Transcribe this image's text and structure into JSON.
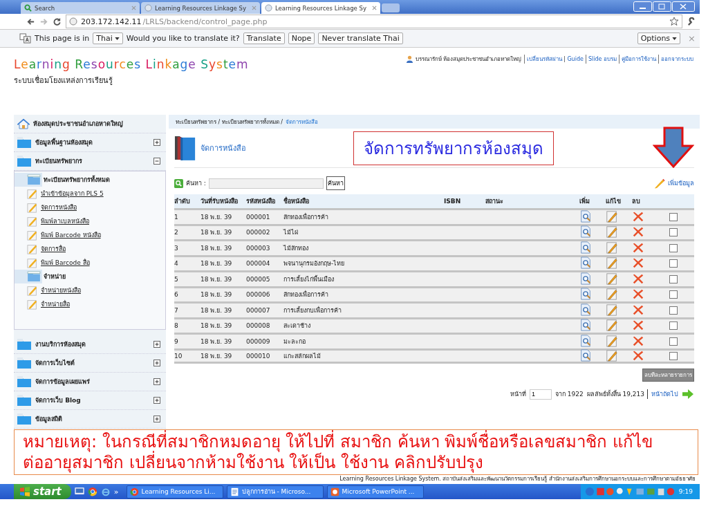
{
  "browser": {
    "tabs": [
      {
        "label": "Search",
        "kind": "search",
        "selected": false
      },
      {
        "label": "Learning Resources Linkage Sy",
        "kind": "page",
        "selected": false
      },
      {
        "label": "Learning Resources Linkage Sy",
        "kind": "page",
        "selected": true
      }
    ],
    "url_host": "203.172.142.11",
    "url_path": "/LRLS/backend/control_page.php",
    "translate_bar": {
      "prefix": "This page is in",
      "language": "Thai",
      "question": "Would you like to translate it?",
      "buttons": [
        "Translate",
        "Nope",
        "Never translate Thai"
      ],
      "options": "Options",
      "close": "×"
    }
  },
  "header": {
    "logo": "Learning Resources Linkage System",
    "subtitle": "ระบบเชื่อมโยงแหล่งการเรียนรู้",
    "user": "บรรณารักษ์ ห้องสมุดประชาชนอำเภอหาดใหญ่",
    "links": [
      "เปลี่ยนรหัสผ่าน",
      "Guide",
      "Slide อบรม",
      "คู่มือการใช้งาน",
      "ออกจากระบบ"
    ]
  },
  "sidebar": {
    "header": "ห้องสมุดประชาชนอำเภอหาดใหญ่",
    "groups": [
      {
        "label": "ข้อมูลพื้นฐานห้องสมุด",
        "expanded": false
      },
      {
        "label": "ทะเบียนทรัพยากร",
        "expanded": true,
        "children": [
          {
            "label": "ทะเบียนทรัพยากรทั้งหมด",
            "kind": "folder"
          },
          {
            "label": "นำเข้าข้อมูลจาก PLS 5",
            "kind": "link"
          },
          {
            "label": "จัดการหนังสือ",
            "kind": "link"
          },
          {
            "label": "พิมพ์ลาเบลหนังสือ",
            "kind": "link"
          },
          {
            "label": "พิมพ์ Barcode หนังสือ",
            "kind": "link"
          },
          {
            "label": "จัดการสื่อ",
            "kind": "link"
          },
          {
            "label": "พิมพ์ Barcode สื่อ",
            "kind": "link"
          },
          {
            "label": "จำหน่าย",
            "kind": "folder"
          },
          {
            "label": "จำหน่ายหนังสือ",
            "kind": "link"
          },
          {
            "label": "จำหน่ายสื่อ",
            "kind": "link"
          }
        ]
      },
      {
        "label": "งานบริการห้องสมุด",
        "expanded": false
      },
      {
        "label": "จัดการเว็บไซต์",
        "expanded": false
      },
      {
        "label": "จัดการข้อมูลเผยแพร่",
        "expanded": false
      },
      {
        "label": "จัดการเว็บ Blog",
        "expanded": false
      },
      {
        "label": "ข้อมูลสถิติ",
        "expanded": false
      }
    ]
  },
  "content": {
    "breadcrumb": {
      "path": "ทะเบียนทรัพยากร / ทะเบียนทรัพยากรทั้งหมด /",
      "current": "จัดการหนังสือ"
    },
    "title": "จัดการหนังสือ",
    "callout": "จัดการทรัพยากรห้องสมุด",
    "add_link": "เพิ่มข้อมูล",
    "search": {
      "label": "ค้นหา :",
      "button": "ค้นหา"
    },
    "table": {
      "columns": [
        "ลำดับ",
        "วันที่รับหนังสือ",
        "รหัสหนังสือ",
        "ชื่อหนังสือ",
        "ISBN",
        "สถานะ",
        "เพิ่ม",
        "แก้ไข",
        "ลบ"
      ],
      "rows": [
        {
          "no": "1",
          "date": "18 พ.ย. 39",
          "code": "000001",
          "name": "สักทองเพื่อการค้า",
          "checked": false
        },
        {
          "no": "2",
          "date": "18 พ.ย. 39",
          "code": "000002",
          "name": "ไม้ไผ่",
          "checked": false
        },
        {
          "no": "3",
          "date": "18 พ.ย. 39",
          "code": "000003",
          "name": "ไม้สักทอง",
          "checked": false
        },
        {
          "no": "4",
          "date": "18 พ.ย. 39",
          "code": "000004",
          "name": "พจนานุกรมอังกฤษ-ไทย",
          "checked": false
        },
        {
          "no": "5",
          "date": "18 พ.ย. 39",
          "code": "000005",
          "name": "การเลี้ยงไก่พื้นเมือง",
          "checked": false
        },
        {
          "no": "6",
          "date": "18 พ.ย. 39",
          "code": "000006",
          "name": "สักทองเพื่อการค้า",
          "checked": false
        },
        {
          "no": "7",
          "date": "18 พ.ย. 39",
          "code": "000007",
          "name": "การเลี้ยงกบเพื่อการค้า",
          "checked": false
        },
        {
          "no": "8",
          "date": "18 พ.ย. 39",
          "code": "000008",
          "name": "สะเดาช้าง",
          "checked": false
        },
        {
          "no": "9",
          "date": "18 พ.ย. 39",
          "code": "000009",
          "name": "มะละกอ",
          "checked": false
        },
        {
          "no": "10",
          "date": "18 พ.ย. 39",
          "code": "000010",
          "name": "แกะสลักผลไม้",
          "checked": false
        }
      ]
    },
    "bulk_delete": "ลบทีละหลายรายการ",
    "pager": {
      "label": "หน้าที่",
      "page": "1",
      "of": "จาก 1922",
      "total": "ผลลัพธ์ทั้งสิ้น 19,213",
      "next": "หน้าถัดไป"
    }
  },
  "note": "หมายเหตุ: ในกรณีที่สมาชิกหมดอายุ ให้ไปที่ สมาชิก ค้นหา พิมพ์ชื่อหรือเลขสมาชิก แก้ไข ต่ออายุสมาชิก  เปลี่ยนจากห้ามใช้งาน ให้เป็น ใช้งาน คลิกปรับปรุง",
  "footer": "Learning Resources Linkage System. สถาบันส่งเสริมและพัฒนานวัตกรรมการเรียนรู้ สำนักงานส่งเสริมการศึกษานอกระบบและการศึกษาตามอัธยาศัย",
  "taskbar": {
    "start": "start",
    "more": "»",
    "tasks": [
      {
        "label": "Learning Resources Li...",
        "kind": "chrome"
      },
      {
        "label": "ปลูกการอ่าน - Microso...",
        "kind": "word"
      },
      {
        "label": "Microsoft PowerPoint ...",
        "kind": "powerpoint"
      }
    ],
    "clock": "9:19"
  }
}
